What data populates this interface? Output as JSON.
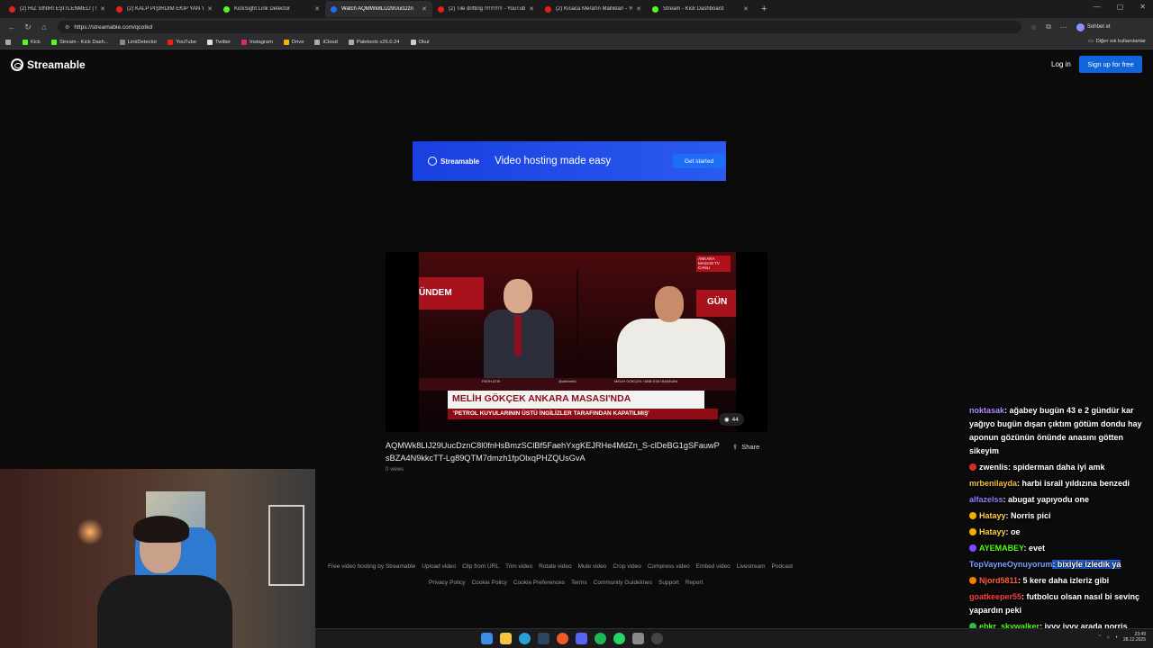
{
  "browser": {
    "tabs": [
      {
        "title": "(2) HIZ SINIRI EŞİTLENMELİ | 5Sır",
        "color": "#e62117"
      },
      {
        "title": "(2) KALP PİŞİRDİM EKİP YAN YATTI",
        "color": "#e62117"
      },
      {
        "title": "KickSight Link Detector",
        "color": "#53fc18"
      },
      {
        "title": "Watch AQMWk8LIJ29UucDzn",
        "color": "#1b6ef5"
      },
      {
        "title": "(2) Tile drifting !!!!!!!!!!!! - YouTube",
        "color": "#e62117"
      },
      {
        "title": "(2) Kısaca Meral'in Mallıkları - You",
        "color": "#e62117"
      },
      {
        "title": "Stream - Kick Dashboard",
        "color": "#53fc18"
      }
    ],
    "active_tab_index": 3,
    "url": "https://streamable.com/qcotkd",
    "profile_label": "Sohbet et",
    "bookmarks": [
      {
        "label": "Kick",
        "color": "#53fc18"
      },
      {
        "label": "Stream - Kick Dash...",
        "color": "#53fc18"
      },
      {
        "label": "LinkDetector",
        "color": "#888888"
      },
      {
        "label": "YouTube",
        "color": "#e62117"
      },
      {
        "label": "Twitter",
        "color": "#dddddd"
      },
      {
        "label": "Instagram",
        "color": "#d62976"
      },
      {
        "label": "Drive",
        "color": "#f4b400"
      },
      {
        "label": "iCloud",
        "color": "#aaaaaa"
      },
      {
        "label": "Paletools v26.0.24",
        "color": "#aaaaaa"
      },
      {
        "label": "Okul",
        "color": "#cccccc"
      }
    ],
    "other_bookmarks": "Diğer sık kullanılanlar"
  },
  "site": {
    "logo": "Streamable",
    "login": "Log in",
    "signup": "Sign up for free",
    "banner": {
      "brand": "Streamable",
      "text": "Video hosting made easy",
      "cta": "Get started"
    },
    "video": {
      "title": "AQMWk8LIJ29UucDznC8l0fnHsBmzSClBf5FaehYxgKEJRHe4MdZn_S-clDeBG1gSFauwPsBZA4N9kkcTT-Lg89QTM7dmzh1fpOlxqPHZQUsGvA",
      "views": "0 views",
      "share": "Share",
      "overlay_count": "44",
      "tv_left_band": "ÜNDEM",
      "tv_right_band": "GÜN",
      "tv_logo": "ANKARA MASASI TV CANLI",
      "caption_name_left": "FATİH ATİK",
      "caption_handle": "@atikfatih1",
      "caption_name_right": "MELİH GÖKÇEK / ABB ESKİ BAŞKANI",
      "lower_third": "MELİH GÖKÇEK ANKARA MASASI'NDA",
      "lower_sub": "'PETROL KUYULARININ ÜSTÜ İNGİLİZLER TARAFINDAN KAPATILMIŞ'"
    },
    "footer_row1": [
      "Free video hosting by Streamable",
      "Upload video",
      "Clip from URL",
      "Trim video",
      "Rotate video",
      "Mute video",
      "Crop video",
      "Compress video",
      "Embed video",
      "Livestream",
      "Podcast"
    ],
    "footer_row2": [
      "Privacy Policy",
      "Cookie Policy",
      "Cookie Preferences",
      "Terms",
      "Community Guidelines",
      "Support",
      "Report"
    ]
  },
  "chat": [
    {
      "user": "noktasak",
      "color": "#b08cff",
      "text": ": ağabey bugün 43 e 2 gündür kar yağıyo bugün dışarı çıktım götüm dondu hay aponun gözünün önünde anasını götten sikeyim"
    },
    {
      "user": "zwenlis",
      "color": "#ffffff",
      "text": ": spiderman daha iyi amk"
    },
    {
      "user": "mrbenilayda",
      "color": "#f0c040",
      "text": ": harbi israil yıldızına benzedi"
    },
    {
      "user": "alfazelss",
      "color": "#9a7cff",
      "text": ": abugat yapıyodu one"
    },
    {
      "user": "Hatayy",
      "color": "#ffd24a",
      "text": ": Norris pici"
    },
    {
      "user": "Hatayy",
      "color": "#ffd24a",
      "text": ": oe"
    },
    {
      "user": "AYEMABEY",
      "color": "#53fc18",
      "text": ": evet"
    },
    {
      "user": "TopVayneOynuyorum",
      "color": "#7aa2ff",
      "text": ": bixiyle izledik ya"
    },
    {
      "user": "Njord5811",
      "color": "#ff5a3c",
      "text": ": 5 kere daha izleriz gibi"
    },
    {
      "user": "goatkeeper55",
      "color": "#ff4040",
      "text": ": futbolcu olsan nasıl bi sevinç yapardın peki"
    },
    {
      "user": "ebkr_skywalker",
      "color": "#53fc18",
      "text": ": iyyy iyyy arada norris gorduk"
    }
  ],
  "taskbar": {
    "time": "23:49",
    "date": "28.12.2025"
  }
}
